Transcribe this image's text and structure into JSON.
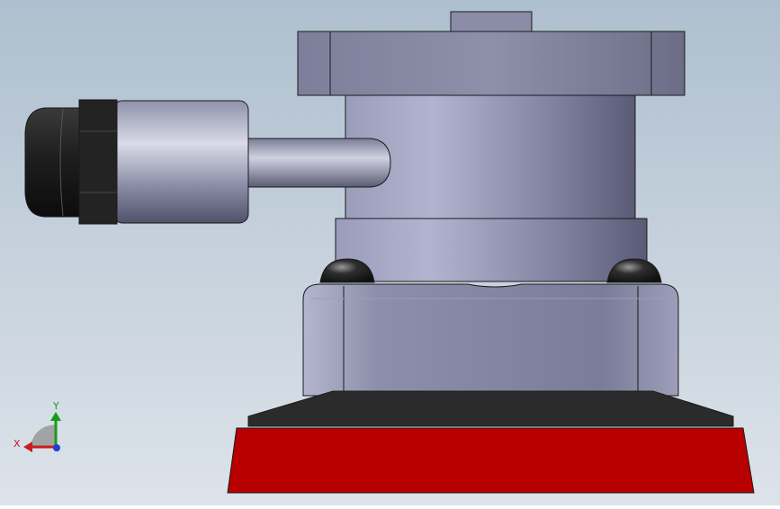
{
  "viewport": {
    "background_top": "#aebfcf",
    "background_bottom": "#dde3ea"
  },
  "model": {
    "body_color": "#8a8ca8",
    "body_shadow": "#5e5f7a",
    "body_highlight": "#b4b6cf",
    "outline_color": "#1a1a1a",
    "pad_color": "#b80000",
    "pad_backing_color": "#2b2b2b",
    "hose_fitting_color": "#222222",
    "bump_color": "#333333"
  },
  "triad": {
    "x_label": "X",
    "y_label": "Y",
    "x_color": "#c81e1e",
    "y_color": "#1a9a1a",
    "z_color": "#1f3fd0"
  }
}
